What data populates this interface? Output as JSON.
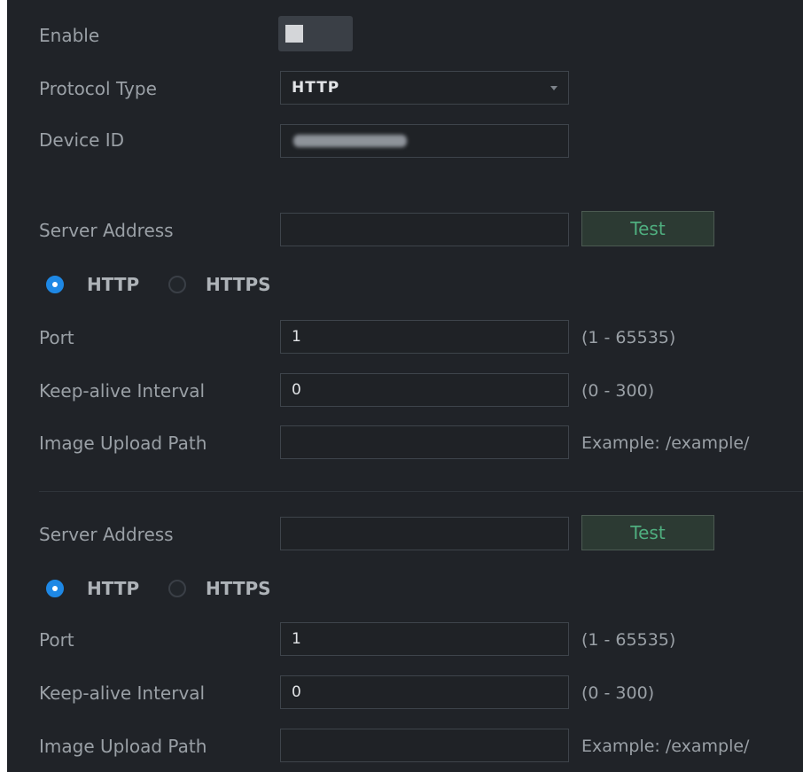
{
  "enable": {
    "label": "Enable",
    "on": false
  },
  "protocol": {
    "label": "Protocol Type",
    "value": "HTTP"
  },
  "device_id": {
    "label": "Device ID"
  },
  "servers": [
    {
      "address_label": "Server Address",
      "address_value": "",
      "test_label": "Test",
      "options": [
        "HTTP",
        "HTTPS"
      ],
      "selected": "HTTP",
      "port_label": "Port",
      "port_value": "1",
      "port_range": "(1 - 65535)",
      "keepalive_label": "Keep-alive Interval",
      "keepalive_value": "0",
      "keepalive_range": "(0 - 300)",
      "upload_label": "Image Upload Path",
      "upload_value": "",
      "upload_example": "Example: /example/"
    },
    {
      "address_label": "Server Address",
      "address_value": "",
      "test_label": "Test",
      "options": [
        "HTTP",
        "HTTPS"
      ],
      "selected": "HTTP",
      "port_label": "Port",
      "port_value": "1",
      "port_range": "(1 - 65535)",
      "keepalive_label": "Keep-alive Interval",
      "keepalive_value": "0",
      "keepalive_range": "(0 - 300)",
      "upload_label": "Image Upload Path",
      "upload_value": "",
      "upload_example": "Example: /example/"
    }
  ],
  "colors": {
    "background": "#202328",
    "accent": "#1e88e5",
    "test_text": "#4fae7f"
  },
  "icons": {
    "dropdown": "chevron-down-icon"
  }
}
